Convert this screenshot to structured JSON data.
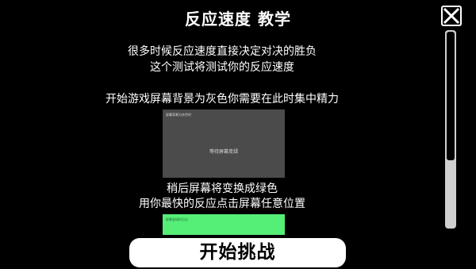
{
  "title": "反应速度 教学",
  "intro": {
    "line1": "很多时候反应速度直接决定对决的胜负",
    "line2": "这个测试将测试你的反应速度"
  },
  "step1": {
    "text": "开始游戏屏幕背景为灰色你需要在此时集中精力",
    "demo_label": "屏幕背景为灰色时",
    "demo_center": "等待屏幕变绿"
  },
  "step2": {
    "line1": "稍后屏幕将变换成绿色",
    "line2": "用你最快的反应点击屏幕任意位置",
    "demo_label": "屏幕变绿时点击"
  },
  "start_button": "开始挑战",
  "icons": {
    "close": "close-x-icon"
  },
  "colors": {
    "background": "#000000",
    "gray_screen": "#4b4b4b",
    "green_screen": "#55ee77",
    "button": "#ffffff"
  }
}
